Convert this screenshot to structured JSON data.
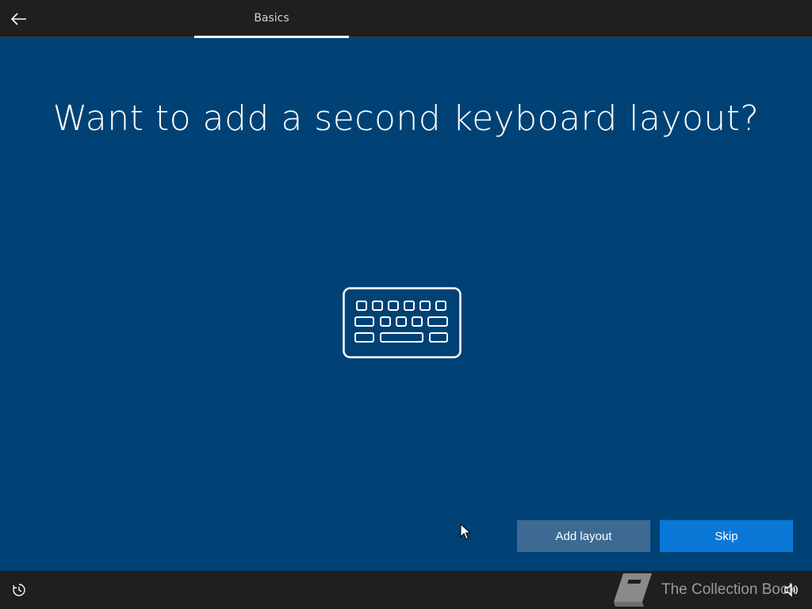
{
  "header": {
    "tab_label": "Basics"
  },
  "main": {
    "title": "Want to add a second keyboard layout?",
    "illustration": "keyboard-icon"
  },
  "actions": {
    "add_layout_label": "Add layout",
    "skip_label": "Skip"
  },
  "footer": {
    "watermark_text": "The Collection Book",
    "ease_of_access_icon": "ease-of-access-icon",
    "volume_icon": "volume-icon"
  },
  "colors": {
    "background": "#004275",
    "bar": "#1f1f1f",
    "primary_button": "#0a78d7",
    "secondary_button": "#3d6a93"
  }
}
